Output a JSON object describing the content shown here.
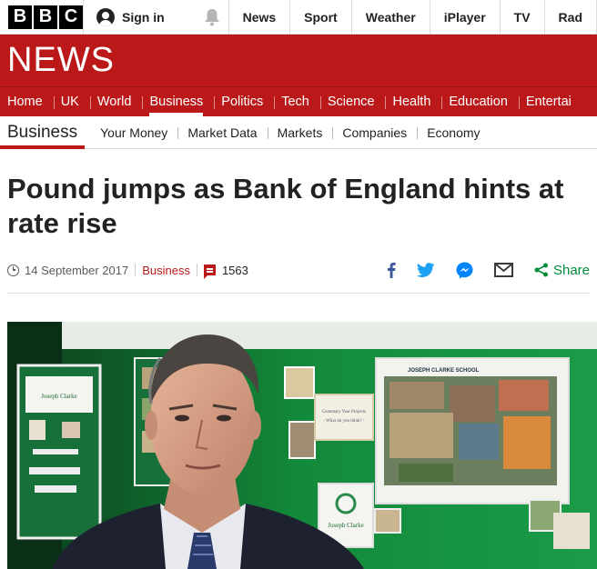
{
  "brand": {
    "letters": [
      "B",
      "B",
      "C"
    ],
    "section_title": "NEWS"
  },
  "account": {
    "signin_label": "Sign in"
  },
  "top_nav": [
    "News",
    "Sport",
    "Weather",
    "iPlayer",
    "TV",
    "Rad"
  ],
  "section_nav": [
    {
      "label": "Home",
      "active": false
    },
    {
      "label": "UK",
      "active": false
    },
    {
      "label": "World",
      "active": false
    },
    {
      "label": "Business",
      "active": true
    },
    {
      "label": "Politics",
      "active": false
    },
    {
      "label": "Tech",
      "active": false
    },
    {
      "label": "Science",
      "active": false
    },
    {
      "label": "Health",
      "active": false
    },
    {
      "label": "Education",
      "active": false
    },
    {
      "label": "Entertai",
      "active": false
    }
  ],
  "sub_nav": {
    "current": "Business",
    "items": [
      "Your Money",
      "Market Data",
      "Markets",
      "Companies",
      "Economy"
    ]
  },
  "article": {
    "headline": "Pound jumps as Bank of England hints at rate rise",
    "date": "14 September 2017",
    "section": "Business",
    "comment_count": "1563",
    "share_label": "Share",
    "share_icons": [
      "facebook-icon",
      "twitter-icon",
      "messenger-icon",
      "email-icon",
      "share-icon"
    ]
  },
  "hero_image": {
    "poster_title": "JOSEPH CLARKE SCHOOL",
    "sign_line1": "Centenary Year Projects",
    "sign_line2": "- What do you think? -",
    "board_label": "Joseph Clarke",
    "lower_label": "Joseph Clarke"
  },
  "colors": {
    "bbc_red": "#bb1919",
    "share_green": "#008c3a",
    "facebook": "#3b5998",
    "twitter": "#1da1f2",
    "messenger": "#0084ff"
  }
}
